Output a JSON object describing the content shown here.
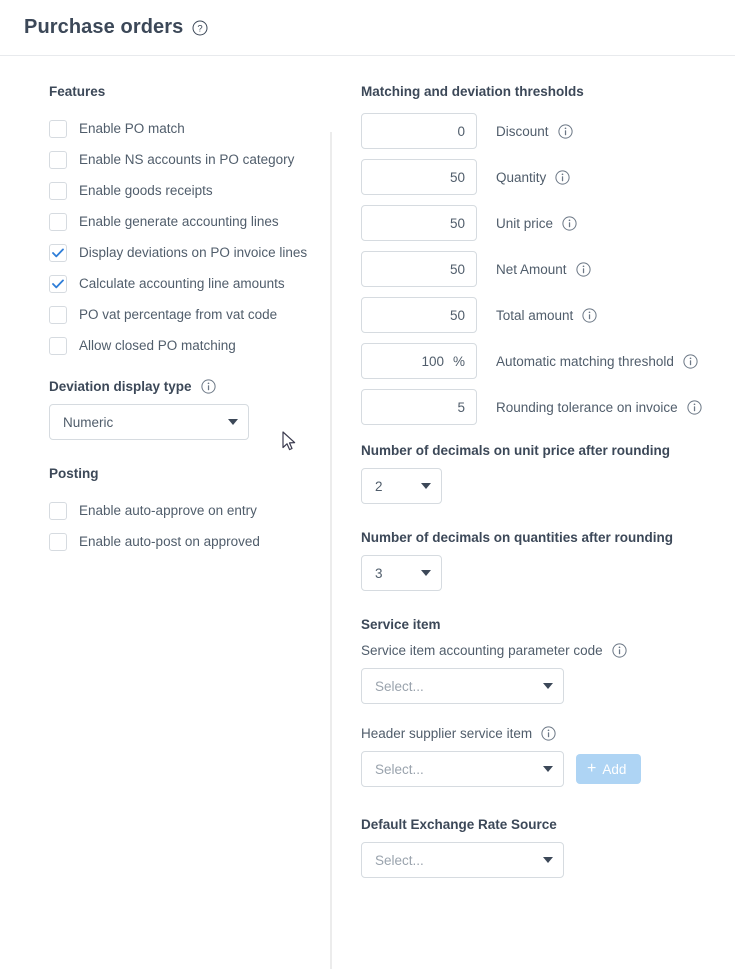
{
  "header": {
    "title": "Purchase orders",
    "help_icon": "question-circle-icon"
  },
  "left": {
    "features_title": "Features",
    "features": [
      {
        "label": "Enable PO match",
        "checked": false
      },
      {
        "label": "Enable NS accounts in PO category",
        "checked": false
      },
      {
        "label": "Enable goods receipts",
        "checked": false
      },
      {
        "label": "Enable generate accounting lines",
        "checked": false
      },
      {
        "label": "Display deviations on PO invoice lines",
        "checked": true
      },
      {
        "label": "Calculate accounting line amounts",
        "checked": true
      },
      {
        "label": "PO vat percentage from vat code",
        "checked": false
      },
      {
        "label": "Allow closed PO matching",
        "checked": false
      }
    ],
    "deviation_display": {
      "label": "Deviation display type",
      "info_icon": "info-circle-icon",
      "value": "Numeric"
    },
    "posting_title": "Posting",
    "posting": [
      {
        "label": "Enable auto-approve on entry",
        "checked": false
      },
      {
        "label": "Enable auto-post on approved",
        "checked": false
      }
    ]
  },
  "right": {
    "thresholds_title": "Matching and deviation thresholds",
    "thresholds": [
      {
        "value": "0",
        "suffix": "",
        "label": "Discount",
        "info_icon": "info-circle-icon"
      },
      {
        "value": "50",
        "suffix": "",
        "label": "Quantity",
        "info_icon": "info-circle-icon"
      },
      {
        "value": "50",
        "suffix": "",
        "label": "Unit price",
        "info_icon": "info-circle-icon"
      },
      {
        "value": "50",
        "suffix": "",
        "label": "Net Amount",
        "info_icon": "info-circle-icon"
      },
      {
        "value": "50",
        "suffix": "",
        "label": "Total amount",
        "info_icon": "info-circle-icon"
      },
      {
        "value": "100",
        "suffix": "%",
        "label": "Automatic matching threshold",
        "info_icon": "info-circle-icon"
      },
      {
        "value": "5",
        "suffix": "",
        "label": "Rounding tolerance on invoice",
        "info_icon": "info-circle-icon"
      }
    ],
    "decimals_unit_price": {
      "label": "Number of decimals on unit price after rounding",
      "value": "2"
    },
    "decimals_quantities": {
      "label": "Number of decimals on quantities after rounding",
      "value": "3"
    },
    "service_item_title": "Service item",
    "service_item_code": {
      "label": "Service item accounting parameter code",
      "info_icon": "info-circle-icon",
      "value": "Select..."
    },
    "header_supplier_service_item": {
      "label": "Header supplier service item",
      "info_icon": "info-circle-icon",
      "value": "Select...",
      "add_button": "Add"
    },
    "exchange_rate": {
      "label": "Default Exchange Rate Source",
      "value": "Select..."
    }
  },
  "colors": {
    "accent": "#2f7ed8",
    "text": "#3c4858",
    "muted": "#9aa3ad",
    "border": "#d6dbe0",
    "button_disabled": "#aed4f4"
  }
}
